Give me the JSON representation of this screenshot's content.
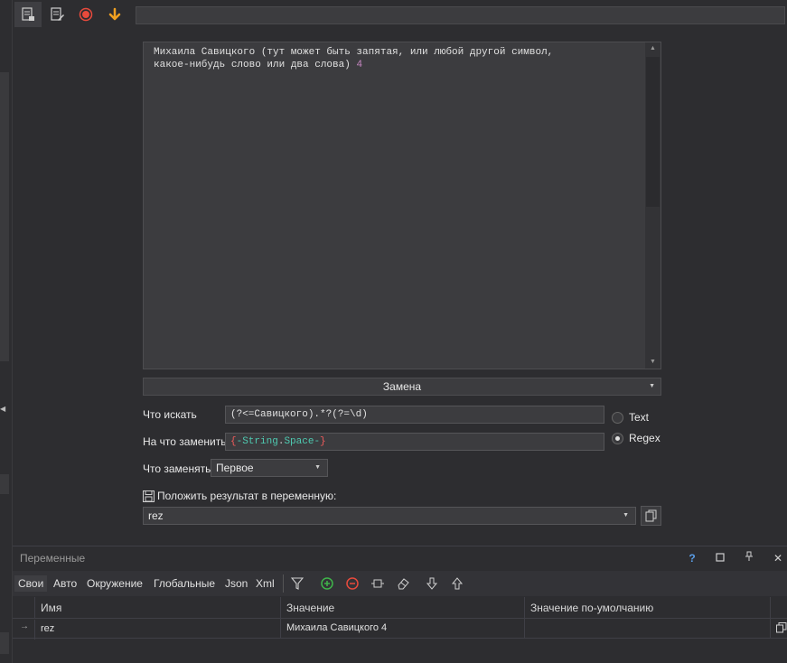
{
  "toolbar": {
    "buttons": [
      {
        "name": "script-list-icon",
        "active": true
      },
      {
        "name": "script-edit-icon",
        "active": false
      },
      {
        "name": "record-icon",
        "active": false
      },
      {
        "name": "arrow-down-icon",
        "active": false
      }
    ],
    "search_value": ""
  },
  "editor": {
    "text_line1": "Михаила Савицкого (тут может быть запятая, или любой другой символ,",
    "text_line2": "какое-нибудь слово или два слова) ",
    "text_number": "4"
  },
  "mode": {
    "label": "Замена"
  },
  "form": {
    "find_label": "Что искать",
    "find_value": "(?<=Савицкого).*?(?=\\d)",
    "replace_label": "На что заменить",
    "replace_open": "{",
    "replace_part1": "-String",
    "replace_dot": ".",
    "replace_part2": "Space-",
    "replace_close": "}",
    "which_label": "Что заменять",
    "which_value": "Первое",
    "save_label": "Положить результат в переменную:",
    "save_value": "rez",
    "radio_text": "Text",
    "radio_regex": "Regex",
    "radio_selected": "Regex"
  },
  "panel": {
    "title": "Переменные",
    "tabs": [
      "Свои",
      "Авто",
      "Окружение",
      "Глобальные",
      "Json",
      "Xml"
    ],
    "active_tab": "Свои",
    "columns": [
      "Имя",
      "Значение",
      "Значение по-умолчанию"
    ],
    "rows": [
      {
        "name": "rez",
        "value": "Михаила Савицкого 4",
        "default": ""
      }
    ]
  },
  "colors": {
    "background": "#2d2d30",
    "editor_bg": "#3c3c3f",
    "record": "#e84a3c",
    "arrow": "#f0a020",
    "add": "#3fb54a",
    "remove": "#e84a3c",
    "accent_help": "#5a9ee8"
  }
}
